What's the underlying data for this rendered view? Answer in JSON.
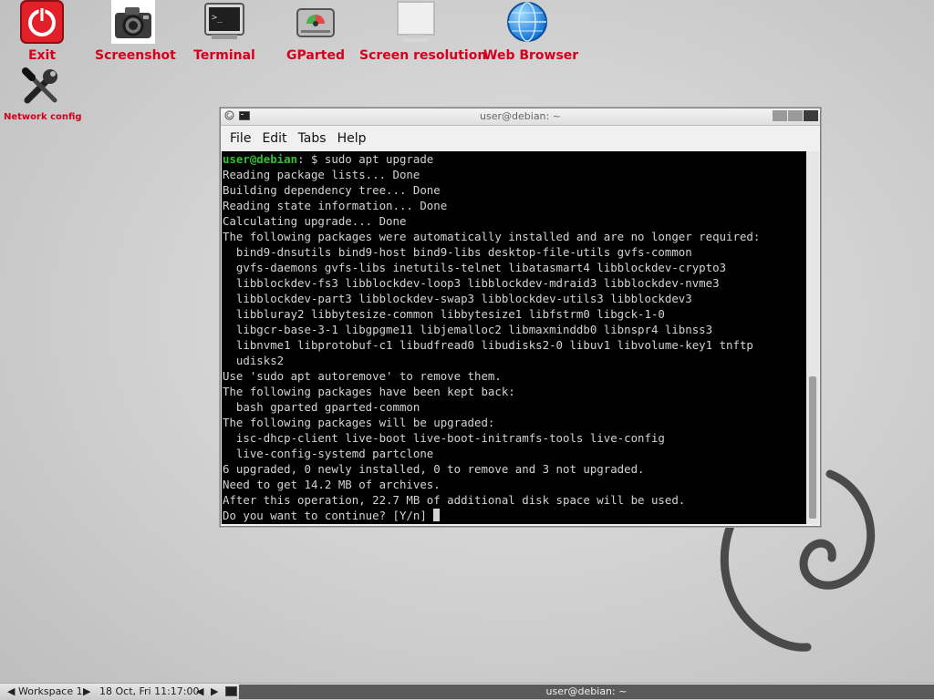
{
  "desktop": {
    "icons": [
      {
        "label": "Exit"
      },
      {
        "label": "Screenshot"
      },
      {
        "label": "Terminal"
      },
      {
        "label": "GParted"
      },
      {
        "label": "Screen resolution"
      },
      {
        "label": "Web Browser"
      },
      {
        "label": "Network config"
      }
    ]
  },
  "window": {
    "title": "user@debian: ~",
    "menu": [
      "File",
      "Edit",
      "Tabs",
      "Help"
    ]
  },
  "terminal": {
    "prompt_user": "user@debian",
    "prompt_rest": ": $ sudo apt upgrade",
    "lines": [
      "Reading package lists... Done",
      "Building dependency tree... Done",
      "Reading state information... Done",
      "Calculating upgrade... Done",
      "The following packages were automatically installed and are no longer required:",
      "  bind9-dnsutils bind9-host bind9-libs desktop-file-utils gvfs-common",
      "  gvfs-daemons gvfs-libs inetutils-telnet libatasmart4 libblockdev-crypto3",
      "  libblockdev-fs3 libblockdev-loop3 libblockdev-mdraid3 libblockdev-nvme3",
      "  libblockdev-part3 libblockdev-swap3 libblockdev-utils3 libblockdev3",
      "  libbluray2 libbytesize-common libbytesize1 libfstrm0 libgck-1-0",
      "  libgcr-base-3-1 libgpgme11 libjemalloc2 libmaxminddb0 libnspr4 libnss3",
      "  libnvme1 libprotobuf-c1 libudfread0 libudisks2-0 libuv1 libvolume-key1 tnftp",
      "  udisks2",
      "Use 'sudo apt autoremove' to remove them.",
      "The following packages have been kept back:",
      "  bash gparted gparted-common",
      "The following packages will be upgraded:",
      "  isc-dhcp-client live-boot live-boot-initramfs-tools live-config",
      "  live-config-systemd partclone",
      "6 upgraded, 0 newly installed, 0 to remove and 3 not upgraded.",
      "Need to get 14.2 MB of archives.",
      "After this operation, 22.7 MB of additional disk space will be used."
    ],
    "last_line": "Do you want to continue? [Y/n] "
  },
  "taskbar": {
    "workspace": "Workspace 1",
    "clock": "18 Oct, Fri 11:17:00",
    "task": "user@debian: ~"
  },
  "colors": {
    "label_red": "#d6001c",
    "prompt_green": "#30c030"
  }
}
